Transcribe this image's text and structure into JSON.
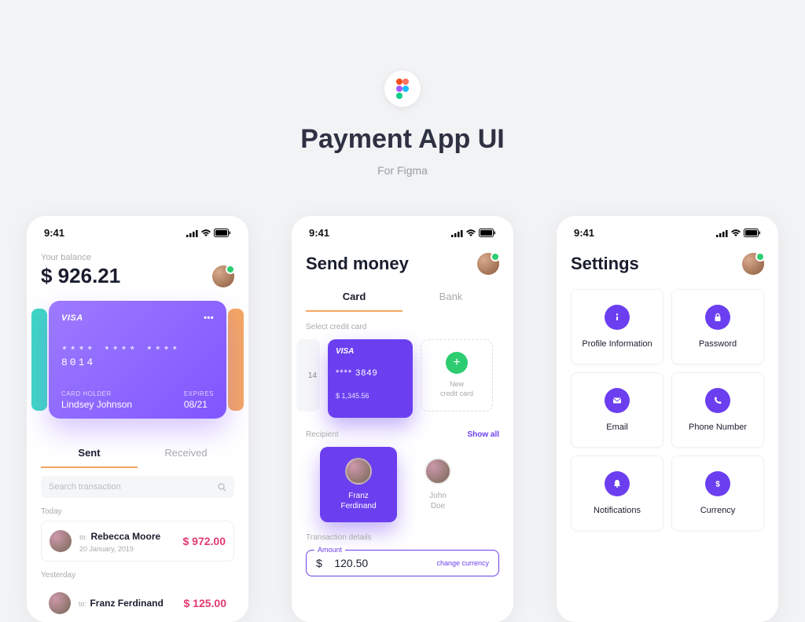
{
  "header": {
    "title": "Payment App UI",
    "subtitle": "For Figma"
  },
  "status_time": "9:41",
  "screen1": {
    "balance_label": "Your balance",
    "balance": "$ 926.21",
    "card": {
      "brand": "VISA",
      "number": "**** **** **** 8014",
      "holder_label": "CARD HOLDER",
      "holder": "Lindsey Johnson",
      "expires_label": "EXPIRES",
      "expires": "08/21"
    },
    "tabs": {
      "sent": "Sent",
      "received": "Received"
    },
    "search_placeholder": "Search transaction",
    "sections": {
      "today": "Today",
      "yesterday": "Yesterday"
    },
    "txn1": {
      "to": "to:",
      "name": "Rebecca Moore",
      "date": "20 January, 2019",
      "amount": "$ 972.00"
    },
    "txn2": {
      "to": "to:",
      "name": "Franz Ferdinand",
      "amount": "$ 125.00"
    }
  },
  "screen2": {
    "title": "Send money",
    "tabs": {
      "card": "Card",
      "bank": "Bank"
    },
    "select_label": "Select credit card",
    "cc_frag": "14",
    "cc": {
      "brand": "VISA",
      "number": "**** 3849",
      "balance": "$ 1,345.56"
    },
    "new_card": "New\ncredit card",
    "recipient_label": "Recipient",
    "show_all": "Show all",
    "r1": "Franz\nFerdinand",
    "r2": "John\nDoe",
    "tx_details": "Transaction details",
    "amount_label": "Amount",
    "amount": "$    120.50",
    "change_currency": "change currency"
  },
  "screen3": {
    "title": "Settings",
    "tiles": [
      "Profile Information",
      "Password",
      "Email",
      "Phone Number",
      "Notifications",
      "Currency"
    ]
  }
}
